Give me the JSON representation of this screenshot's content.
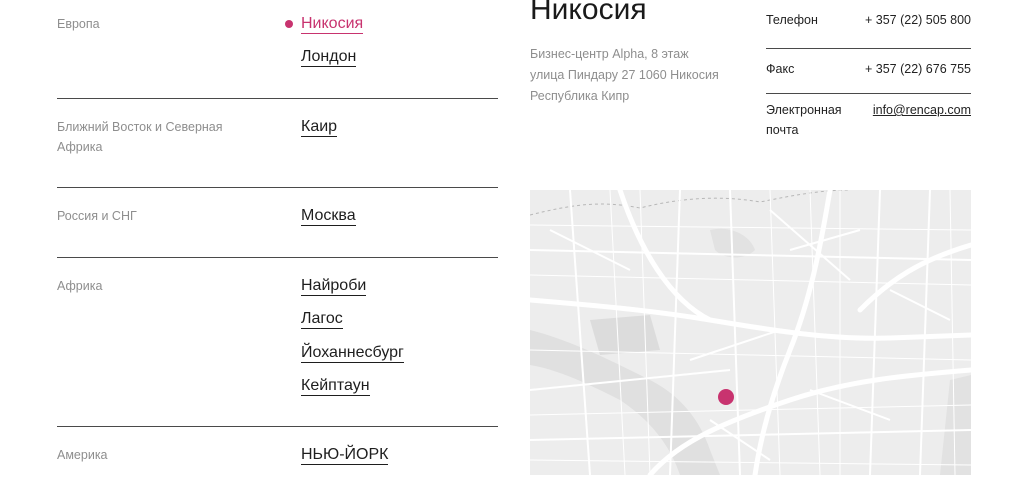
{
  "regions": [
    {
      "name": "Европа",
      "cities": [
        {
          "label": "Никосия",
          "active": true
        },
        {
          "label": "Лондон",
          "active": false
        }
      ]
    },
    {
      "name": "Ближний Восток и Северная Африка",
      "cities": [
        {
          "label": "Каир",
          "active": false
        }
      ]
    },
    {
      "name": "Россия и СНГ",
      "cities": [
        {
          "label": "Москва",
          "active": false
        }
      ]
    },
    {
      "name": "Африка",
      "cities": [
        {
          "label": "Найроби",
          "active": false
        },
        {
          "label": "Лагос",
          "active": false
        },
        {
          "label": "Йоханнесбург",
          "active": false
        },
        {
          "label": "Кейптаун",
          "active": false
        }
      ]
    },
    {
      "name": "Америка",
      "cities": [
        {
          "label": "НЬЮ-ЙОРК",
          "active": false
        }
      ]
    }
  ],
  "office": {
    "title": "Никосия",
    "address_lines": [
      "Бизнес-центр Alpha, 8 этаж",
      "улица Пиндару 27 1060 Никосия",
      "Республика Кипр"
    ]
  },
  "contacts": {
    "phone_label": "Телефон",
    "phone_value": "+ 357 (22) 505 800",
    "fax_label": "Факс",
    "fax_value": "+ 357 (22) 676 755",
    "email_label": "Электронная почта",
    "email_value": "info@rencap.com"
  },
  "colors": {
    "accent": "#c8336f",
    "muted_text": "#8e8e8e",
    "map_background": "#ededed"
  },
  "map": {
    "marker_icon": "location-marker-icon"
  }
}
